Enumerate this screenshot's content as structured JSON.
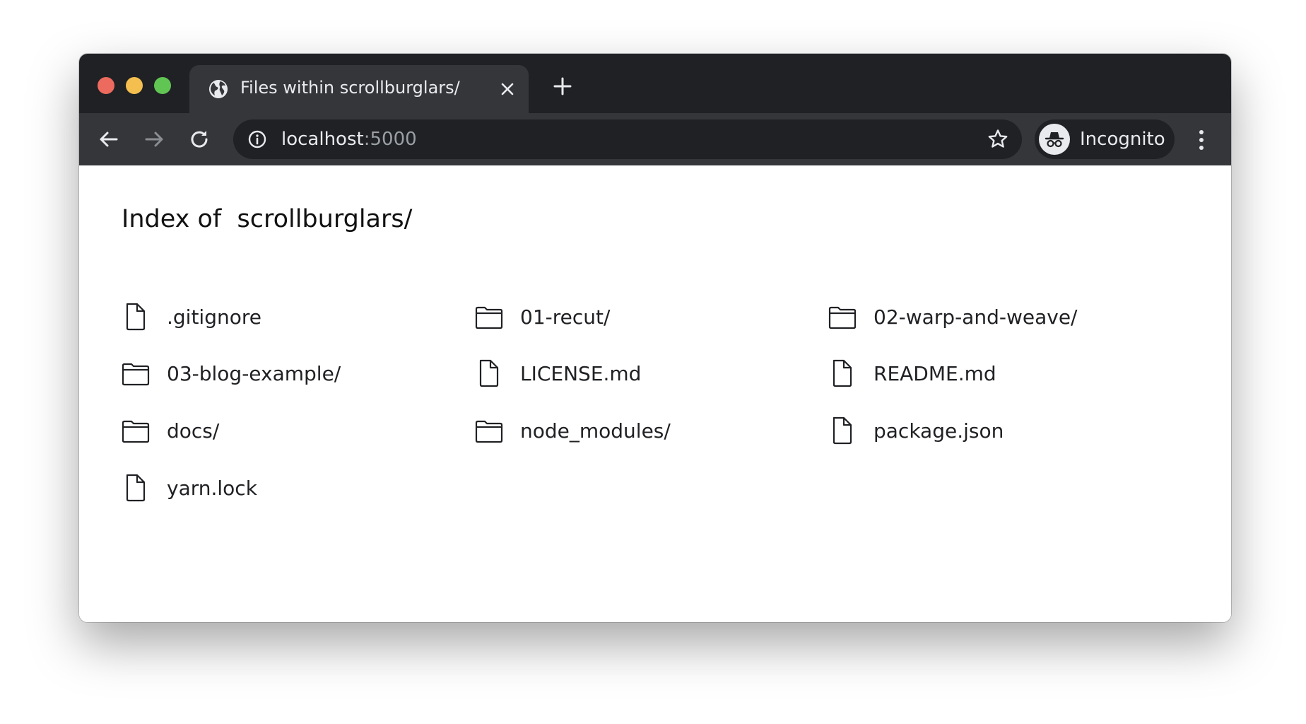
{
  "browser": {
    "tab": {
      "title": "Files within scrollburglars/"
    },
    "address": {
      "host": "localhost",
      "port": ":5000"
    },
    "profile": {
      "label": "Incognito"
    }
  },
  "page": {
    "heading": "Index of  scrollburglars/",
    "entries": [
      {
        "name": ".gitignore",
        "type": "file"
      },
      {
        "name": "01-recut/",
        "type": "folder"
      },
      {
        "name": "02-warp-and-weave/",
        "type": "folder"
      },
      {
        "name": "03-blog-example/",
        "type": "folder"
      },
      {
        "name": "LICENSE.md",
        "type": "file"
      },
      {
        "name": "README.md",
        "type": "file"
      },
      {
        "name": "docs/",
        "type": "folder"
      },
      {
        "name": "node_modules/",
        "type": "folder"
      },
      {
        "name": "package.json",
        "type": "file"
      },
      {
        "name": "yarn.lock",
        "type": "file"
      }
    ]
  }
}
